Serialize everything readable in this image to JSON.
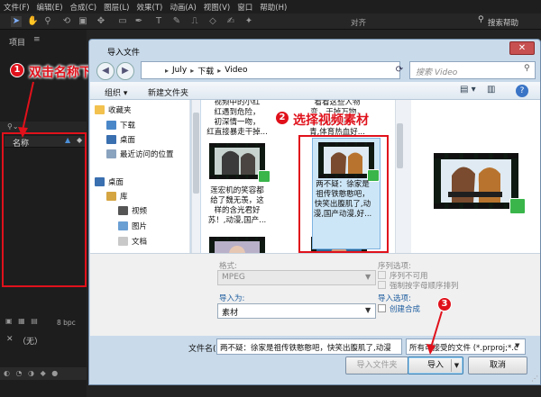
{
  "ae": {
    "menu": [
      "文件(F)",
      "编辑(E)",
      "合成(C)",
      "图层(L)",
      "效果(T)",
      "动画(A)",
      "视图(V)",
      "窗口",
      "帮助(H)"
    ],
    "align_label": "对齐",
    "search_help": "搜索帮助",
    "project_title": "项目",
    "project_menu": "≡",
    "name_column": "名称",
    "bpc": "8 bpc",
    "none_label": "（无）",
    "bottom_icons": "▣ ▦ ▤",
    "bottom_strip": "◐ ◔ ◑ ◆ ●"
  },
  "annotations": {
    "step1_num": "1",
    "step1_text": "双击名称下的空白处",
    "step2_num": "2",
    "step2_text": "选择视频素材",
    "step3_num": "3"
  },
  "dialog": {
    "title": "导入文件",
    "close": "✕",
    "address": [
      "July",
      "下载",
      "Video"
    ],
    "search_placeholder": "搜索 Video",
    "organize": "组织 ▾",
    "new_folder": "新建文件夹",
    "nav": {
      "favorites": "收藏夹",
      "downloads": "下载",
      "desktop": "桌面",
      "recent": "最近访问的位置",
      "desktop2": "桌面",
      "library": "库",
      "videos": "视频",
      "pictures": "图片",
      "documents": "文档"
    },
    "files": {
      "top_caption_1": "视频中的小红\n红遇到危险，\n初深情一吻，\n红直接暴走干掉...",
      "top_caption_2": "看看这些人物\n变，干掉万物，\n看你喜欢哪一个\n青,体育热血好...",
      "caption_1": "莲宏机的笑容都\n给了魏无羡，这\n样的含光君好\n苏！,动漫,国产...",
      "caption_2": "两不疑：徐家是\n祖传铁憨憨吧，\n快笑出腹肌了,动\n漫,国产动漫,好..."
    },
    "options": {
      "format_label": "格式:",
      "format_value": "MPEG",
      "import_as_label": "导入为:",
      "import_as_value": "素材",
      "sequence_label": "序列选项:",
      "seq_unavailable": "序列不可用",
      "force_alpha": "强制按字母顺序排列",
      "import_options_label": "导入选项:",
      "create_comp": "创建合成"
    },
    "filename_label": "文件名(N):",
    "filename_value": "两不疑：徐家是祖传铁憨憨吧，快笑出腹肌了,动漫",
    "filetype_value": "所有可接受的文件 (*.prproj;*.c",
    "import_folder": "导入文件夹",
    "import": "导入",
    "cancel": "取消"
  },
  "colors": {
    "annotation_red": "#e0111b",
    "dialog_frame": "#c9daea",
    "import_options_blue": "#1c5c9e"
  }
}
